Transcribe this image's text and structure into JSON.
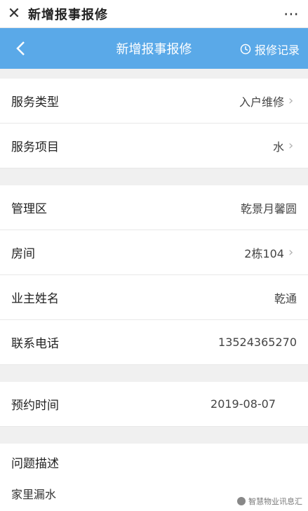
{
  "topbar": {
    "title": "新增报事报修"
  },
  "navbar": {
    "title": "新增报事报修",
    "record_label": "报修记录"
  },
  "rows": [
    {
      "label": "服务类型",
      "value": "入户维修"
    },
    {
      "label": "服务项目",
      "value": "水"
    },
    {
      "label": "管理区",
      "value": "乾景月馨圆"
    },
    {
      "label": "房间",
      "value": "2栋104"
    },
    {
      "label": "业主姓名",
      "value": "乾通"
    },
    {
      "label": "联系电话",
      "value": "13524365270"
    },
    {
      "label": "预约时间",
      "value": "2019-08-07"
    }
  ],
  "description": {
    "label": "问题描述",
    "text": "家里漏水"
  },
  "footer": {
    "tag": "智慧物业讯息汇"
  },
  "colors": {
    "nav": "#5aa9e8"
  }
}
